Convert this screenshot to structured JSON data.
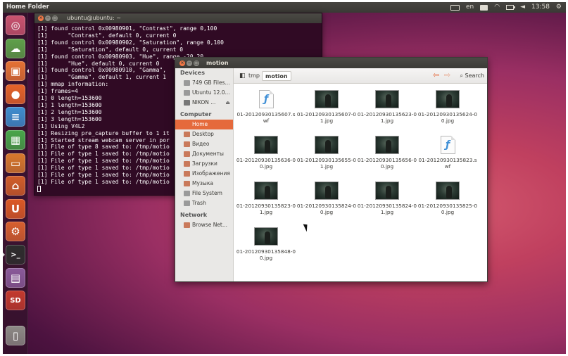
{
  "top_panel": {
    "title": "Home Folder",
    "keyboard_layout": "en",
    "clock": "13:58"
  },
  "launcher": {
    "items": [
      {
        "name": "dash-home-icon",
        "glyph": "◎",
        "color": "#c95470"
      },
      {
        "name": "ubuntu-one-icon",
        "glyph": "☁",
        "color": "#5fa14a"
      },
      {
        "name": "home-folder-icon",
        "glyph": "▣",
        "color": "#e67234"
      },
      {
        "name": "firefox-icon",
        "glyph": "●",
        "color": "#e6642a"
      },
      {
        "name": "libreoffice-writer-icon",
        "glyph": "≡",
        "color": "#3e8ed0"
      },
      {
        "name": "libreoffice-calc-icon",
        "glyph": "▦",
        "color": "#48a64a"
      },
      {
        "name": "libreoffice-impress-icon",
        "glyph": "▭",
        "color": "#d8792d"
      },
      {
        "name": "ubuntu-software-center-icon",
        "glyph": "⌂",
        "color": "#d15e2a"
      },
      {
        "name": "ubuntu-one-music-icon",
        "glyph": "U",
        "color": "#dc5a26"
      },
      {
        "name": "system-settings-icon",
        "glyph": "⚙",
        "color": "#d8602f"
      },
      {
        "name": "terminal-icon",
        "glyph": ">_",
        "color": "#2d2d2d"
      },
      {
        "name": "workspace-switcher-icon",
        "glyph": "▤",
        "color": "#8a5a9a"
      },
      {
        "name": "sd-card-icon",
        "glyph": "SD",
        "color": "#c43a2e"
      },
      {
        "name": "trash-icon",
        "glyph": "▯",
        "color": "#8d8a86"
      }
    ]
  },
  "terminal": {
    "title": "ubuntu@ubuntu: ~",
    "lines": [
      "[1] found control 0x00980901, \"Contrast\", range 0,100",
      "[1]      \"Contrast\", default 0, current 0",
      "[1] found control 0x00980902, \"Saturation\", range 0,100",
      "[1]      \"Saturation\", default 0, current 0",
      "[1] found control 0x00980903, \"Hue\", range -20,20",
      "[1]      \"Hue\", default 0, current 0",
      "[1] found control 0x00980910, \"Gamma\",",
      "[1]      \"Gamma\", default 1, current 1",
      "[1] mmap information:",
      "[1] frames=4",
      "[1] 0 length=153600",
      "[1] 1 length=153600",
      "[1] 2 length=153600",
      "[1] 3 length=153600",
      "[1] Using V4L2",
      "[1] Resizing pre_capture buffer to 1 it",
      "[1] Started stream webcam server in por",
      "[1] File of type 8 saved to: /tmp/motio",
      "[1] File of type 1 saved to: /tmp/motio",
      "[1] File of type 1 saved to: /tmp/motio",
      "[1] File of type 1 saved to: /tmp/motio",
      "[1] File of type 1 saved to: /tmp/motio",
      "[1] File of type 1 saved to: /tmp/motio"
    ]
  },
  "file_manager": {
    "title": "motion",
    "sidebar": {
      "devices_heading": "Devices",
      "devices": [
        {
          "label": "749 GB Files...",
          "icon": "drive-icon",
          "color": "#9a9a9a",
          "eject": ""
        },
        {
          "label": "Ubuntu 12.0...",
          "icon": "disc-icon",
          "color": "#9a9a9a",
          "eject": ""
        },
        {
          "label": "NIKON ...",
          "icon": "camera-icon",
          "color": "#777777",
          "eject": "⏏"
        }
      ],
      "computer_heading": "Computer",
      "computer": [
        {
          "label": "Home",
          "icon": "home-icon",
          "color": "#e56a3c"
        },
        {
          "label": "Desktop",
          "icon": "desktop-icon",
          "color": "#c9795a"
        },
        {
          "label": "Видео",
          "icon": "video-icon",
          "color": "#c9795a"
        },
        {
          "label": "Документы",
          "icon": "documents-icon",
          "color": "#c9795a"
        },
        {
          "label": "Загрузки",
          "icon": "downloads-icon",
          "color": "#c9795a"
        },
        {
          "label": "Изображения",
          "icon": "pictures-icon",
          "color": "#c9795a"
        },
        {
          "label": "Музыка",
          "icon": "music-icon",
          "color": "#c9795a"
        },
        {
          "label": "File System",
          "icon": "filesystem-icon",
          "color": "#9a9a9a"
        },
        {
          "label": "Trash",
          "icon": "trash-icon",
          "color": "#9a9a9a"
        }
      ],
      "network_heading": "Network",
      "network": [
        {
          "label": "Browse Net...",
          "icon": "network-icon",
          "color": "#c9795a"
        }
      ]
    },
    "breadcrumbs": [
      "tmp",
      "motion"
    ],
    "search_label": "Search",
    "files": [
      {
        "name": "01-20120930135607.swf",
        "type": "swf"
      },
      {
        "name": "01-20120930135607-01.jpg",
        "type": "jpg"
      },
      {
        "name": "01-20120930135623-01.jpg",
        "type": "jpg"
      },
      {
        "name": "01-20120930135624-00.jpg",
        "type": "jpg"
      },
      {
        "name": "01-20120930135636-00.jpg",
        "type": "jpg"
      },
      {
        "name": "01-20120930135655-01.jpg",
        "type": "jpg"
      },
      {
        "name": "01-20120930135656-00.jpg",
        "type": "jpg"
      },
      {
        "name": "01-20120930135823.swf",
        "type": "swf"
      },
      {
        "name": "01-20120930135823-01.jpg",
        "type": "jpg"
      },
      {
        "name": "01-20120930135824-00.jpg",
        "type": "jpg"
      },
      {
        "name": "01-20120930135824-01.jpg",
        "type": "jpg"
      },
      {
        "name": "01-20120930135825-00.jpg",
        "type": "jpg"
      },
      {
        "name": "01-20120930135848-00.jpg",
        "type": "jpg"
      }
    ]
  }
}
